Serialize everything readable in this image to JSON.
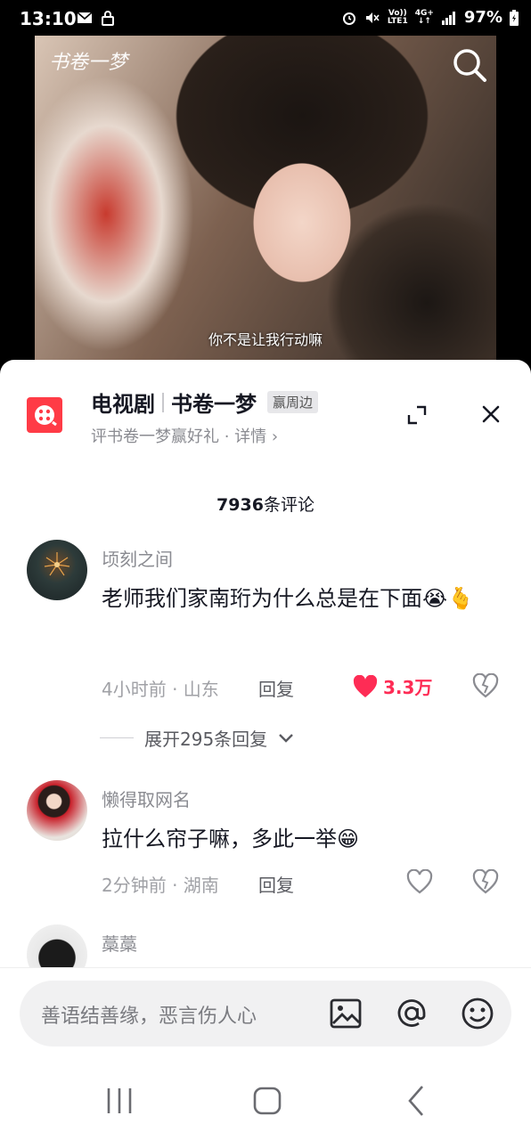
{
  "status_bar": {
    "time": "13:10",
    "battery": "97%",
    "network_top": "Vo))",
    "network_bottom": "LTE1",
    "net_type": "4G+"
  },
  "video": {
    "logo_text": "书卷一梦",
    "subtitle": "你不是让我行动嘛"
  },
  "show": {
    "category": "电视剧",
    "name": "书卷一梦",
    "badge": "赢周边",
    "subline": "评书卷一梦赢好礼 · 详情"
  },
  "comments_header": {
    "count": "7936",
    "suffix": "条评论"
  },
  "comments": [
    {
      "user": "顷刻之间",
      "text": "老师我们家南珩为什么总是在下面😭🫰",
      "time_location": "4小时前 · 山东",
      "reply_label": "回复",
      "likes": "3.3万",
      "liked": true,
      "expand_label": "展开295条回复"
    },
    {
      "user": "懒得取网名",
      "text": "拉什么帘子嘛，多此一举😁",
      "time_location": "2分钟前 · 湖南",
      "reply_label": "回复",
      "likes": "",
      "liked": false
    },
    {
      "user": "藁藁"
    }
  ],
  "input": {
    "placeholder": "善语结善缘，恶言伤人心"
  },
  "colors": {
    "accent": "#fe2c55",
    "show_icon": "#ff3b46"
  }
}
